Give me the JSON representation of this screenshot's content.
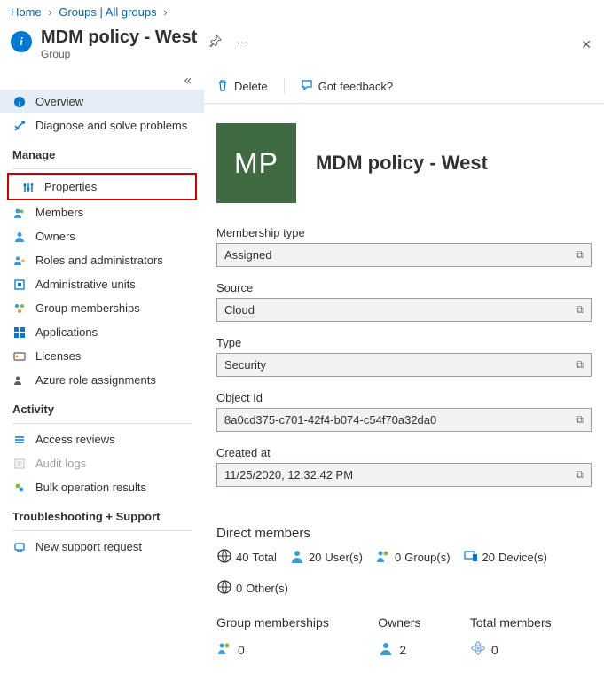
{
  "breadcrumb": {
    "home": "Home",
    "groups": "Groups | All groups"
  },
  "title": "MDM policy - West",
  "subtitle": "Group",
  "sidebar": {
    "overview": "Overview",
    "diagnose": "Diagnose and solve problems",
    "manage_header": "Manage",
    "properties": "Properties",
    "members": "Members",
    "owners": "Owners",
    "roles": "Roles and administrators",
    "admin_units": "Administrative units",
    "group_memberships": "Group memberships",
    "applications": "Applications",
    "licenses": "Licenses",
    "azure_roles": "Azure role assignments",
    "activity_header": "Activity",
    "access_reviews": "Access reviews",
    "audit_logs": "Audit logs",
    "bulk_results": "Bulk operation results",
    "troubleshoot_header": "Troubleshooting + Support",
    "support_request": "New support request"
  },
  "toolbar": {
    "delete": "Delete",
    "feedback": "Got feedback?"
  },
  "hero": {
    "initials": "MP",
    "name": "MDM policy - West"
  },
  "fields": {
    "membership_type": {
      "label": "Membership type",
      "value": "Assigned"
    },
    "source": {
      "label": "Source",
      "value": "Cloud"
    },
    "type": {
      "label": "Type",
      "value": "Security"
    },
    "object_id": {
      "label": "Object Id",
      "value": "8a0cd375-c701-42f4-b074-c54f70a32da0"
    },
    "created_at": {
      "label": "Created at",
      "value": "11/25/2020, 12:32:42 PM"
    }
  },
  "direct_members": {
    "header": "Direct members",
    "total": "40",
    "total_label": "Total",
    "users": "20",
    "users_label": "User(s)",
    "groups": "0",
    "groups_label": "Group(s)",
    "devices": "20",
    "devices_label": "Device(s)",
    "others": "0",
    "others_label": "Other(s)"
  },
  "footer_stats": {
    "gm_label": "Group memberships",
    "gm_value": "0",
    "owners_label": "Owners",
    "owners_value": "2",
    "total_label": "Total members",
    "total_value": "0"
  }
}
